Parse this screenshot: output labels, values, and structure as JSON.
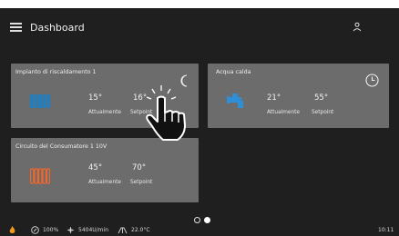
{
  "header": {
    "title": "Dashboard"
  },
  "cards": [
    {
      "title": "Impianto di riscaldamento 1",
      "current_value": "15°",
      "current_label": "Attualmente",
      "setpoint_value": "16°",
      "setpoint_label": "Setpoint",
      "icon": "radiator-icon",
      "mode_icon": "moon-icon"
    },
    {
      "title": "Acqua calda",
      "current_value": "21°",
      "current_label": "Attualmente",
      "setpoint_value": "55°",
      "setpoint_label": "Setpoint",
      "icon": "faucet-icon",
      "mode_icon": "clock-icon"
    },
    {
      "title": "Circuito del Consumatore 1 10V",
      "current_value": "45°",
      "current_label": "Attualmente",
      "setpoint_value": "70°",
      "setpoint_label": "Setpoint",
      "icon": "radiator-icon"
    }
  ],
  "pagination": {
    "pages": 2,
    "active": 2
  },
  "status_bar": {
    "pump_value": "100%",
    "fan_value": "5404U/min",
    "outdoor_temp": "22.0°C",
    "time": "10:11"
  },
  "colors": {
    "background": "#1f1f1f",
    "card": "#6c6c6c",
    "radiator_blue": "#1f7fc1",
    "radiator_orange": "#f2672c",
    "faucet_blue": "#2f8fd6",
    "flame_orange": "#f29a1c"
  }
}
